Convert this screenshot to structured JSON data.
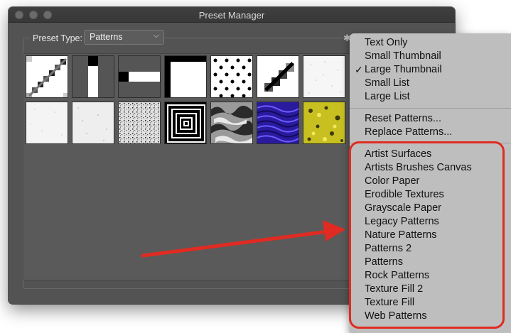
{
  "window": {
    "title": "Preset Manager"
  },
  "preset_type": {
    "label": "Preset Type:",
    "value": "Patterns"
  },
  "icons": {
    "gear": "gear-icon",
    "chevron": "chevron-down-icon",
    "check": "checkmark-icon"
  },
  "menu": {
    "view_items": [
      "Text Only",
      "Small Thumbnail",
      "Large Thumbnail",
      "Small List",
      "Large List"
    ],
    "checked_index": 2,
    "action_items": [
      "Reset Patterns...",
      "Replace Patterns..."
    ],
    "library_items": [
      "Artist Surfaces",
      "Artists Brushes Canvas",
      "Color Paper",
      "Erodible Textures",
      "Grayscale Paper",
      "Legacy Patterns",
      "Nature Patterns",
      "Patterns 2",
      "Patterns",
      "Rock Patterns",
      "Texture Fill 2",
      "Texture Fill",
      "Web Patterns"
    ]
  },
  "colors": {
    "annotation": "#e02b22",
    "menu_bg": "#bebebe",
    "window_bg": "#535353"
  }
}
